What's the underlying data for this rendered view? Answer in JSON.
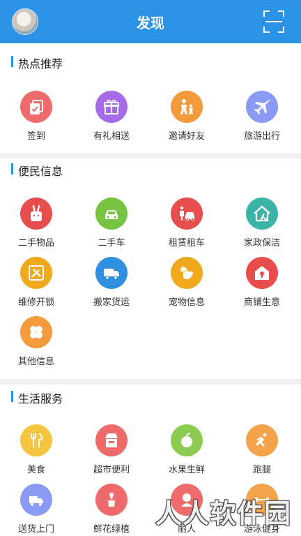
{
  "header": {
    "title": "发现"
  },
  "sections": [
    {
      "title": "热点推荐",
      "items": [
        {
          "label": "签到",
          "color": "#ef6b6b",
          "icon": "checkin-icon"
        },
        {
          "label": "有礼相送",
          "color": "#a86be8",
          "icon": "gift-icon"
        },
        {
          "label": "邀请好友",
          "color": "#f39a3c",
          "icon": "invite-icon"
        },
        {
          "label": "旅游出行",
          "color": "#8a9af5",
          "icon": "plane-icon"
        }
      ]
    },
    {
      "title": "便民信息",
      "items": [
        {
          "label": "二手物品",
          "color": "#e84d4d",
          "icon": "rabbit-bag-icon"
        },
        {
          "label": "二手车",
          "color": "#76c442",
          "icon": "car-icon"
        },
        {
          "label": "租赁租车",
          "color": "#e84d4d",
          "icon": "rent-car-icon"
        },
        {
          "label": "家政保洁",
          "color": "#3bb3a6",
          "icon": "house-clean-icon"
        },
        {
          "label": "维修开锁",
          "color": "#f0a81c",
          "icon": "repair-icon"
        },
        {
          "label": "搬家货运",
          "color": "#2f8fe0",
          "icon": "truck-icon"
        },
        {
          "label": "宠物信息",
          "color": "#f0a81c",
          "icon": "dog-icon"
        },
        {
          "label": "商铺生意",
          "color": "#e84d4d",
          "icon": "shop-icon"
        },
        {
          "label": "其他信息",
          "color": "#f39a3c",
          "icon": "clover-icon"
        }
      ]
    },
    {
      "title": "生活服务",
      "items": [
        {
          "label": "美食",
          "color": "#f5c542",
          "icon": "food-icon"
        },
        {
          "label": "超市便利",
          "color": "#ef6b6b",
          "icon": "supermarket-icon"
        },
        {
          "label": "水果生鲜",
          "color": "#8dcc52",
          "icon": "fruit-icon"
        },
        {
          "label": "跑腿",
          "color": "#f5a34a",
          "icon": "runner-icon"
        },
        {
          "label": "送货上门",
          "color": "#8a9af5",
          "icon": "delivery-icon"
        },
        {
          "label": "鲜花绿植",
          "color": "#ef6b6b",
          "icon": "flower-icon"
        },
        {
          "label": "丽人",
          "color": "#ef6b6b",
          "icon": "beauty-icon"
        },
        {
          "label": "游泳健身",
          "color": "#f5a34a",
          "icon": "fitness-icon"
        }
      ]
    }
  ],
  "watermark": "人人软件园"
}
